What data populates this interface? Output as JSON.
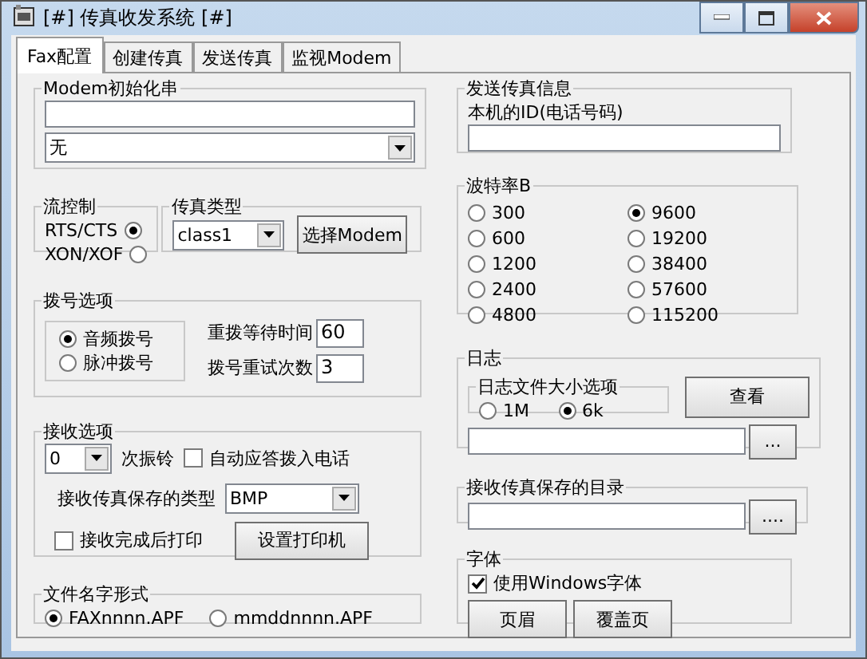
{
  "window": {
    "title": "[#] 传真收发系统 [#]"
  },
  "tabs": [
    {
      "label": "Fax配置",
      "selected": true
    },
    {
      "label": "创建传真",
      "selected": false
    },
    {
      "label": "发送传真",
      "selected": false
    },
    {
      "label": "监视Modem",
      "selected": false
    }
  ],
  "modem_init": {
    "title": "Modem初始化串",
    "dropdown": "无"
  },
  "flow_control": {
    "title": "流控制",
    "options": [
      {
        "label": "RTS/CTS",
        "selected": true
      },
      {
        "label": "XON/XOF",
        "selected": false
      }
    ]
  },
  "fax_type": {
    "title": "传真类型",
    "value": "class1"
  },
  "select_modem_button": "选择Modem",
  "dialing": {
    "title": "拨号选项",
    "modes": [
      {
        "label": "音频拨号",
        "selected": true
      },
      {
        "label": "脉冲拨号",
        "selected": false
      }
    ],
    "fields": [
      {
        "label": "重拨等待时间",
        "value": "60"
      },
      {
        "label": "拨号重试次数",
        "value": "3"
      }
    ]
  },
  "receive": {
    "title": "接收选项",
    "rings_value": "0",
    "rings_label": "次振铃",
    "auto_answer": {
      "label": "自动应答拨入电话",
      "checked": false
    },
    "save_type_label": "接收传真保存的类型",
    "save_type_value": "BMP",
    "print_after": {
      "label": "接收完成后打印",
      "checked": false
    },
    "printer_button": "设置打印机"
  },
  "file_name": {
    "title": "文件名字形式",
    "options": [
      {
        "label": "FAXnnnn.APF",
        "selected": true
      },
      {
        "label": "mmddnnnn.APF",
        "selected": false
      }
    ]
  },
  "send_info": {
    "title": "发送传真信息",
    "id_label": "本机的ID(电话号码)"
  },
  "baud_rate": {
    "title": "波特率B",
    "options": [
      {
        "label": "300",
        "selected": false
      },
      {
        "label": "600",
        "selected": false
      },
      {
        "label": "1200",
        "selected": false
      },
      {
        "label": "2400",
        "selected": false
      },
      {
        "label": "4800",
        "selected": false
      },
      {
        "label": "9600",
        "selected": true
      },
      {
        "label": "19200",
        "selected": false
      },
      {
        "label": "38400",
        "selected": false
      },
      {
        "label": "57600",
        "selected": false
      },
      {
        "label": "115200",
        "selected": false
      }
    ]
  },
  "log": {
    "title": "日志",
    "size_title": "日志文件大小选项",
    "sizes": [
      {
        "label": "1M",
        "selected": false
      },
      {
        "label": "6k",
        "selected": true
      }
    ],
    "view_button": "查看",
    "browse_button": "..."
  },
  "receive_dir": {
    "title": "接收传真保存的目录",
    "browse_button": "...."
  },
  "font": {
    "title": "字体",
    "use_windows": {
      "label": "使用Windows字体",
      "checked": true
    },
    "buttons": [
      "页眉",
      "覆盖页"
    ]
  }
}
